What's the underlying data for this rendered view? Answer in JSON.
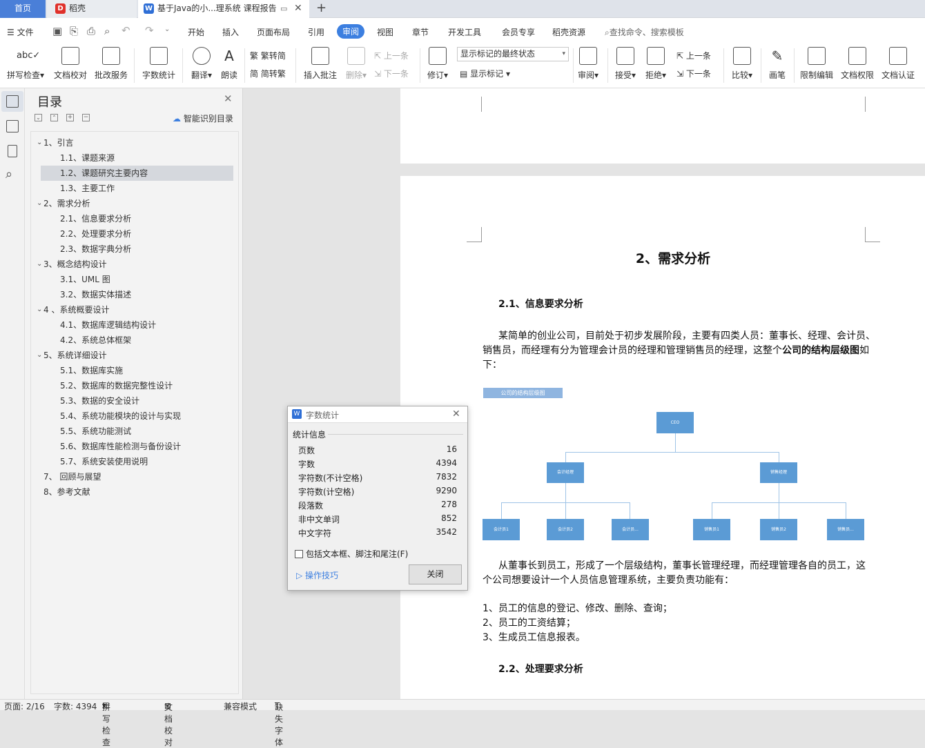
{
  "tabs": {
    "home": "首页",
    "app": "稻壳",
    "doc": "基于Java的小...理系统 课程报告",
    "new_tab": "+"
  },
  "menu": {
    "file": "文件",
    "items": [
      "开始",
      "插入",
      "页面布局",
      "引用",
      "审阅",
      "视图",
      "章节",
      "开发工具",
      "会员专享",
      "稻壳资源"
    ],
    "search_placeholder": "查找命令、搜索模板"
  },
  "ribbon": {
    "spell": "拼写检查",
    "proofread": "文档校对",
    "review_service": "批改服务",
    "word_count": "字数统计",
    "translate": "翻译",
    "read_aloud": "朗读",
    "to_traditional": "繁转简",
    "to_simplified": "简转繁",
    "insert_comment": "插入批注",
    "delete": "删除",
    "prev_comment": "上一条",
    "next_comment": "下一条",
    "revise": "修订",
    "markup_state": "显示标记的最终状态",
    "show_markup": "显示标记",
    "review": "审阅",
    "accept": "接受",
    "reject": "拒绝",
    "prev_change": "上一条",
    "next_change": "下一条",
    "compare": "比较",
    "pen": "画笔",
    "restrict_edit": "限制编辑",
    "doc_permission": "文档权限",
    "doc_cert": "文档认证"
  },
  "toc": {
    "title": "目录",
    "smart": "智能识别目录",
    "items": [
      {
        "level": 1,
        "text": "1、引言"
      },
      {
        "level": 2,
        "text": "1.1、课题来源"
      },
      {
        "level": 2,
        "text": "1.2、课题研究主要内容",
        "selected": true
      },
      {
        "level": 2,
        "text": "1.3、主要工作"
      },
      {
        "level": 1,
        "text": "2、需求分析"
      },
      {
        "level": 2,
        "text": "2.1、信息要求分析"
      },
      {
        "level": 2,
        "text": "2.2、处理要求分析"
      },
      {
        "level": 2,
        "text": "2.3、数据字典分析"
      },
      {
        "level": 1,
        "text": "3、概念结构设计"
      },
      {
        "level": 2,
        "text": "3.1、UML 图"
      },
      {
        "level": 2,
        "text": "3.2、数据实体描述"
      },
      {
        "level": 1,
        "text": "4 、系统概要设计"
      },
      {
        "level": 2,
        "text": "4.1、数据库逻辑结构设计"
      },
      {
        "level": 2,
        "text": "4.2、系统总体框架"
      },
      {
        "level": 1,
        "text": "5、系统详细设计"
      },
      {
        "level": 2,
        "text": "5.1、数据库实施"
      },
      {
        "level": 2,
        "text": "5.2、数据库的数据完整性设计"
      },
      {
        "level": 2,
        "text": "5.3、数据的安全设计"
      },
      {
        "level": 2,
        "text": "5.4、系统功能模块的设计与实现"
      },
      {
        "level": 2,
        "text": "5.5、系统功能测试"
      },
      {
        "level": 2,
        "text": "5.6、数据库性能检测与备份设计"
      },
      {
        "level": 2,
        "text": "5.7、系统安装使用说明"
      },
      {
        "level": 0,
        "text": "7、 回顾与展望"
      },
      {
        "level": 0,
        "text": "8、参考文献"
      }
    ]
  },
  "document": {
    "h1": "2、需求分析",
    "h2_1": "2.1、信息要求分析",
    "p1a": "某简单的创业公司，目前处于初步发展阶段，主要有四类人员：董事长、经理、会计员、",
    "p1b_pre": "销售员，而经理有分为管理会计员的经理和管理销售员的经理，这整个",
    "p1b_bold": "公司的结构层级图",
    "p1b_post": "如",
    "p1c": "下：",
    "chart_title": "公司的结构层级图",
    "org": {
      "ceo": "CEO",
      "mgr1": "会计经理",
      "mgr2": "销售经理",
      "staff": [
        "会计员1",
        "会计员2",
        "会计员...",
        "销售员1",
        "销售员2",
        "销售员..."
      ]
    },
    "p2a": "从董事长到员工，形成了一个层级结构，董事长管理经理，而经理管理各自的员工，这",
    "p2b": "个公司想要设计一个人员信息管理系统，主要负责功能有：",
    "list": [
      "1、员工的信息的登记、修改、删除、查询；",
      "2、员工的工资结算；",
      "3、生成员工信息报表。"
    ],
    "h2_2": "2.2、处理要求分析"
  },
  "dialog": {
    "title": "字数统计",
    "section": "统计信息",
    "rows": [
      {
        "label": "页数",
        "value": "16"
      },
      {
        "label": "字数",
        "value": "4394"
      },
      {
        "label": "字符数(不计空格)",
        "value": "7832"
      },
      {
        "label": "字符数(计空格)",
        "value": "9290"
      },
      {
        "label": "段落数",
        "value": "278"
      },
      {
        "label": "非中文单词",
        "value": "852"
      },
      {
        "label": "中文字符",
        "value": "3542"
      }
    ],
    "checkbox": "包括文本框、脚注和尾注(F)",
    "tips": "操作技巧",
    "close": "关闭"
  },
  "status": {
    "page": "页面: 2/16",
    "words": "字数: 4394",
    "spell": "拼写检查",
    "proof": "文档校对",
    "compat": "兼容模式",
    "missing_font": "缺失字体"
  }
}
